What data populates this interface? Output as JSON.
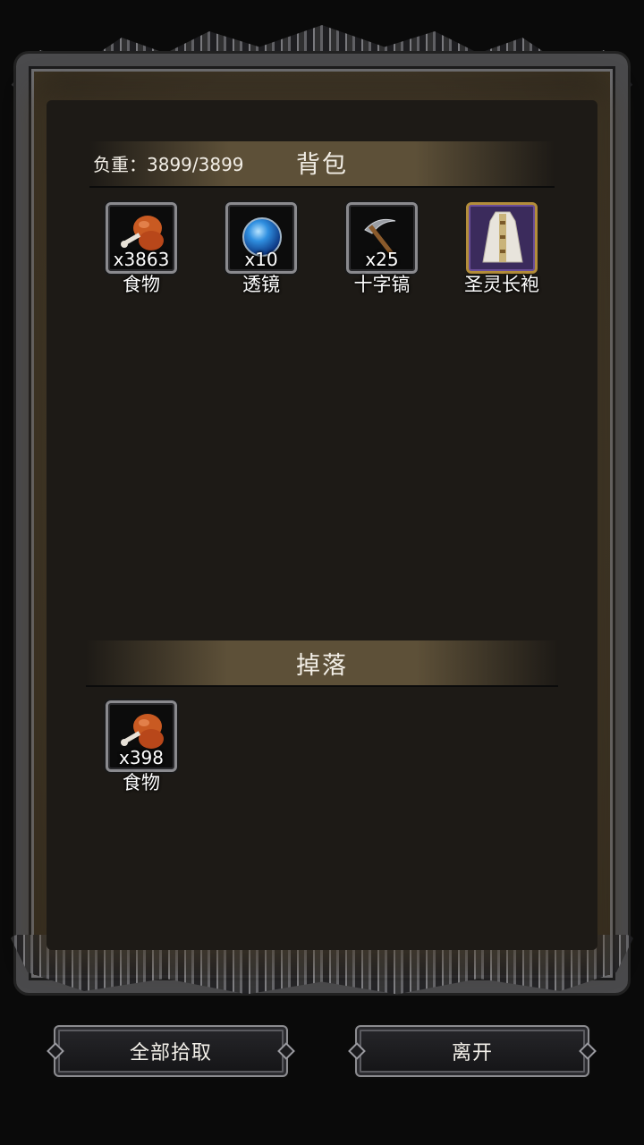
{
  "backpack": {
    "title": "背包",
    "weight_label": "负重：3899/3899",
    "items": [
      {
        "qty": "x3863",
        "name": "食物",
        "icon": "meat-icon"
      },
      {
        "qty": "x10",
        "name": "透镜",
        "icon": "blue-orb-lens-icon"
      },
      {
        "qty": "x25",
        "name": "十字镐",
        "icon": "pickaxe-icon"
      },
      {
        "qty": "",
        "name": "圣灵长袍",
        "icon": "robe-icon"
      }
    ]
  },
  "drops": {
    "title": "掉落",
    "items": [
      {
        "qty": "x398",
        "name": "食物",
        "icon": "meat-icon"
      }
    ]
  },
  "buttons": {
    "pick_all": "全部拾取",
    "leave": "离开"
  },
  "colors": {
    "panel_bg": "#1d1a16",
    "section_bar": "#5d5038",
    "rare_slot_border": "#b38d3a",
    "rare_slot_bg": "#3b2b5c"
  }
}
